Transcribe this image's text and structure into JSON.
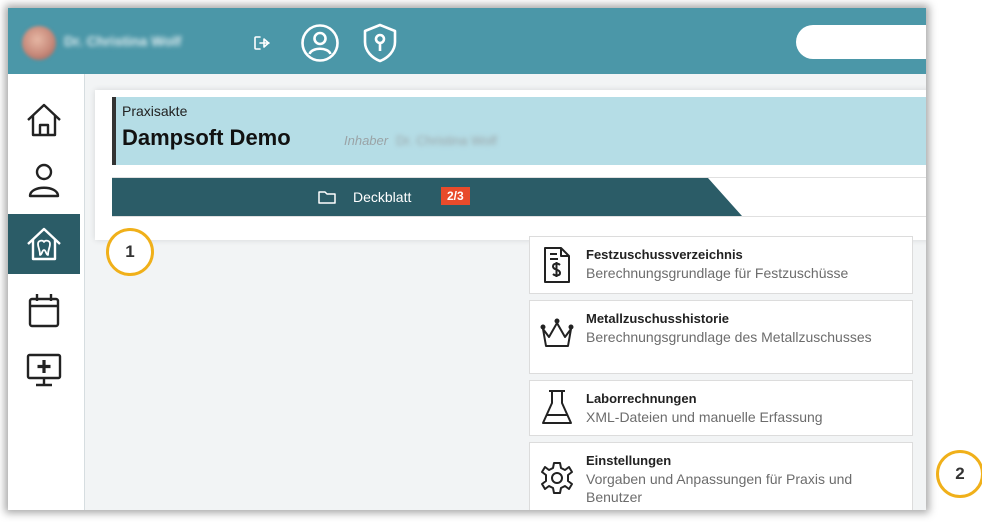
{
  "header": {
    "user_name": "Dr. Christina Wolf",
    "icons": [
      "logout-icon",
      "user-circle-icon",
      "shield-key-icon"
    ],
    "accent_color": "#4b97a8"
  },
  "sidebar": {
    "items": [
      {
        "icon": "home-icon",
        "active": false
      },
      {
        "icon": "person-icon",
        "active": false
      },
      {
        "icon": "practice-tooth-icon",
        "active": true
      },
      {
        "icon": "calendar-icon",
        "active": false
      },
      {
        "icon": "monitor-plus-icon",
        "active": false
      }
    ],
    "active_color": "#2b5c67"
  },
  "card": {
    "section_label": "Praxisakte",
    "practice_name": "Dampsoft Demo",
    "owner_label": "Inhaber",
    "owner_name": "Dr. Christina Wolf"
  },
  "tab": {
    "label": "Deckblatt",
    "badge": "2/3",
    "badge_color": "#e84b2b"
  },
  "tiles": [
    {
      "title": "Festzuschussverzeichnis",
      "description": "Berechnungsgrundlage für Festzuschüsse",
      "icon": "document-dollar-icon"
    },
    {
      "title": "Metallzuschusshistorie",
      "description": "Berechnungsgrundlage des Metallzuschusses",
      "icon": "crown-icon"
    },
    {
      "title": "Laborrechnungen",
      "description": "XML-Dateien und manuelle Erfassung",
      "icon": "flask-icon"
    },
    {
      "title": "Einstellungen",
      "description": "Vorgaben und Anpassungen für Praxis und Benutzer",
      "icon": "gear-icon"
    }
  ],
  "callouts": [
    "1",
    "2"
  ],
  "callout_color": "#f0b01a"
}
